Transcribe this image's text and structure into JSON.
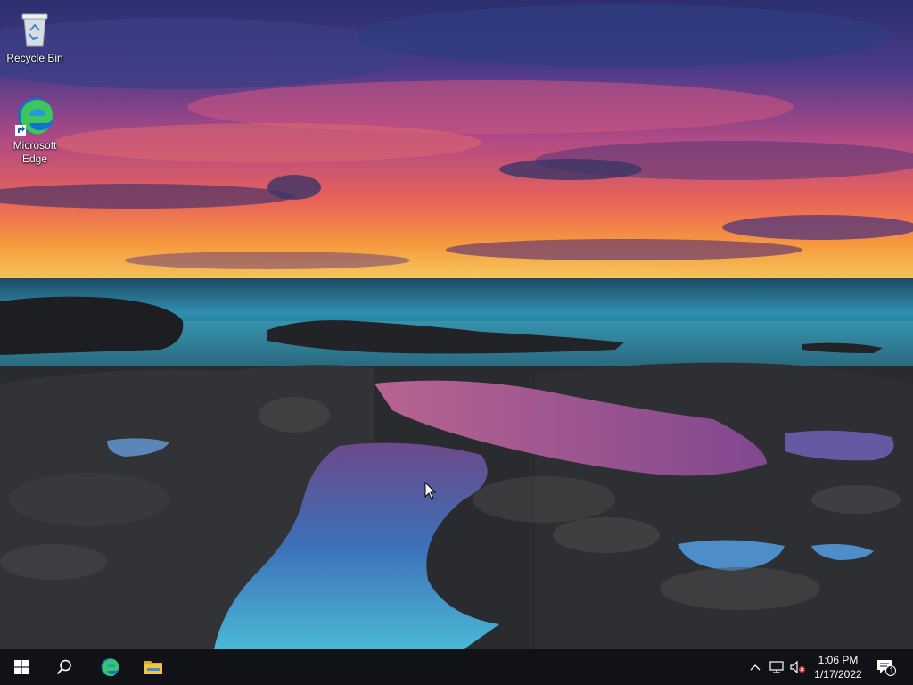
{
  "desktop": {
    "icons": [
      {
        "label": "Recycle Bin",
        "icon": "recycle-bin-icon"
      },
      {
        "label": "Microsoft Edge",
        "icon": "edge-icon"
      }
    ]
  },
  "taskbar": {
    "start_icon": "windows-logo-icon",
    "search_icon": "search-icon",
    "pinned": [
      {
        "icon": "edge-icon"
      },
      {
        "icon": "file-explorer-icon"
      }
    ],
    "tray": {
      "chevron_icon": "chevron-up-icon",
      "network_icon": "network-icon",
      "volume_icon": "volume-muted-icon",
      "notifications_icon": "notifications-icon",
      "notification_count": "1"
    },
    "clock": {
      "time": "1:06 PM",
      "date": "1/17/2022"
    }
  },
  "colors": {
    "taskbar_bg": "#101217",
    "edge_blue": "#0f74d0",
    "edge_green": "#3fc65a",
    "folder_yellow": "#f5c342"
  }
}
